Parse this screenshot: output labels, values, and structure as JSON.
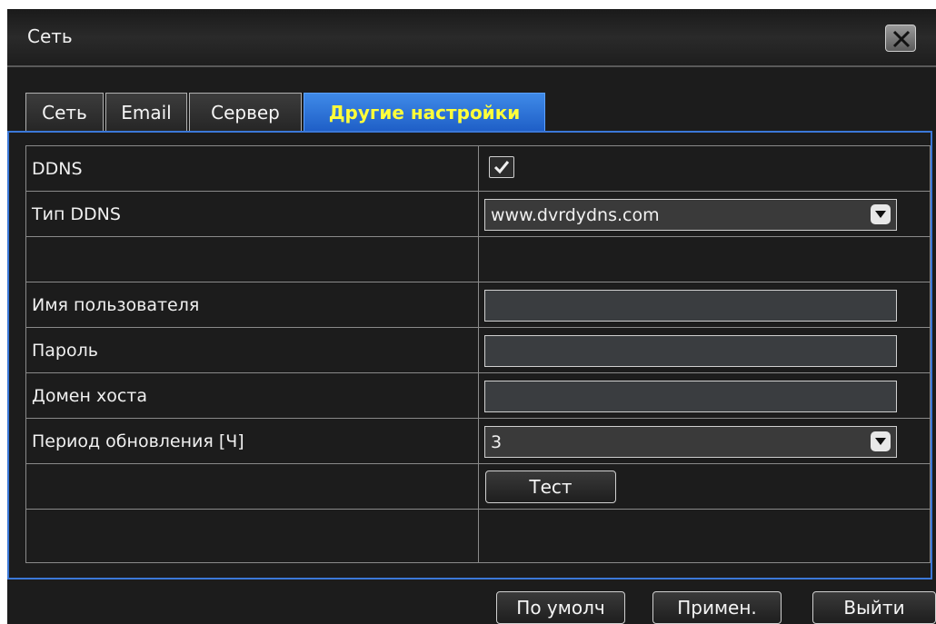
{
  "window": {
    "title": "Сеть",
    "close_icon": "close-icon"
  },
  "tabs": [
    {
      "label": "Сеть",
      "active": false
    },
    {
      "label": "Email",
      "active": false
    },
    {
      "label": "Сервер",
      "active": false
    },
    {
      "label": "Другие настройки",
      "active": true
    }
  ],
  "form": {
    "ddns": {
      "label": "DDNS",
      "checked": true
    },
    "ddns_type": {
      "label": "Тип DDNS",
      "value": "www.dvrdydns.com"
    },
    "username": {
      "label": "Имя пользователя",
      "value": ""
    },
    "password": {
      "label": "Пароль",
      "value": ""
    },
    "host_domain": {
      "label": "Домен хоста",
      "value": ""
    },
    "update_period": {
      "label": "Период обновления [Ч]",
      "value": "3"
    },
    "test_button": "Тест"
  },
  "footer": {
    "default_button": "По умолч",
    "apply_button": "Примен.",
    "exit_button": "Выйти"
  },
  "colors": {
    "accent": "#3b78d8",
    "active_tab_text": "#ffff3a",
    "background": "#1c1c1c"
  }
}
